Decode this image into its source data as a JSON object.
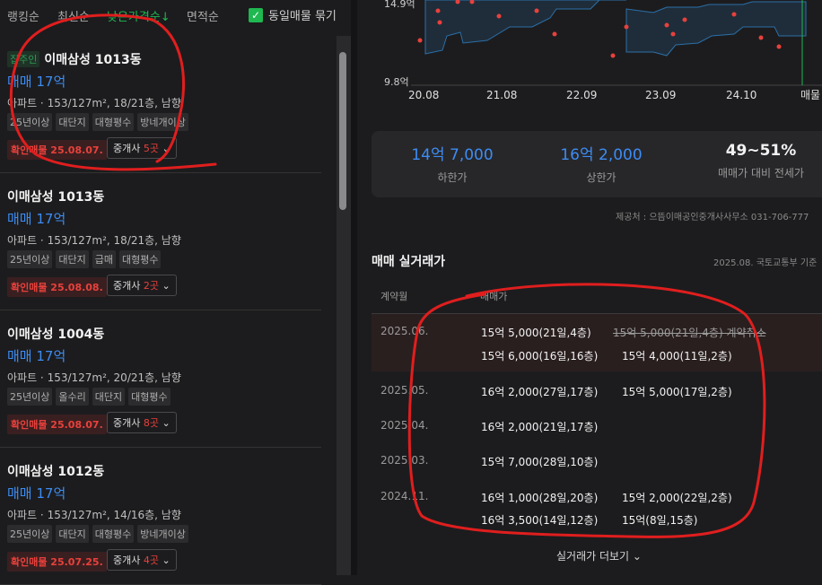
{
  "sort": {
    "items": [
      "랭킹순",
      "최신순",
      "낮은가격순↓",
      "면적순"
    ],
    "active": 2,
    "dup_label": "동일매물 묶기",
    "dup_checked": true
  },
  "listings": [
    {
      "badge": "집주인",
      "name": "이매삼성 1013동",
      "price": "매매 17억",
      "desc": "아파트 · 153/127m², 18/21층, 남향",
      "tags": [
        "25년이상",
        "대단지",
        "대형평수",
        "방네개이상"
      ],
      "confirm": "확인매물 25.08.07.",
      "agent_prefix": "중개사",
      "agent_count": "5곳"
    },
    {
      "badge": "",
      "name": "이매삼성 1013동",
      "price": "매매 17억",
      "desc": "아파트 · 153/127m², 18/21층, 남향",
      "tags": [
        "25년이상",
        "대단지",
        "급매",
        "대형평수"
      ],
      "confirm": "확인매물 25.08.08.",
      "agent_prefix": "중개사",
      "agent_count": "2곳"
    },
    {
      "badge": "",
      "name": "이매삼성 1004동",
      "price": "매매 17억",
      "desc": "아파트 · 153/127m², 20/21층, 남향",
      "tags": [
        "25년이상",
        "올수리",
        "대단지",
        "대형평수"
      ],
      "confirm": "확인매물 25.08.07.",
      "agent_prefix": "중개사",
      "agent_count": "8곳"
    },
    {
      "badge": "",
      "name": "이매삼성 1012동",
      "price": "매매 17억",
      "desc": "아파트 · 153/127m², 14/16층, 남향",
      "tags": [
        "25년이상",
        "대단지",
        "대형평수",
        "방네개이상"
      ],
      "confirm": "확인매물 25.07.25.",
      "agent_prefix": "중개사",
      "agent_count": "4곳"
    }
  ],
  "chart": {
    "y_labels": [
      "14.9억",
      "9.8억"
    ],
    "x_labels": [
      "20.08",
      "21.08",
      "22.09",
      "23.09",
      "24.10",
      "매물"
    ]
  },
  "stats": [
    {
      "value": "14억 7,000",
      "label": "하한가"
    },
    {
      "value": "16억 2,000",
      "label": "상한가"
    },
    {
      "value": "49~51%",
      "label": "매매가 대비 전세가"
    }
  ],
  "source": "제공처 : 으뜸이매공인중개사사무소 031-706-777",
  "section": {
    "title": "매매 실거래가",
    "subtitle": "2025.08. 국토교통부 기준"
  },
  "table": {
    "headers": [
      "계약월",
      "매매가"
    ],
    "rows": [
      {
        "month": "2025.06.",
        "entries": [
          [
            "15억 5,000(21일,4층)",
            "15억 5,000(21일,4층) 계약취소"
          ],
          [
            "15억 6,000(16일,16층)",
            "15억 4,000(11일,2층)"
          ]
        ]
      },
      {
        "month": "2025.05.",
        "entries": [
          [
            "16억 2,000(27일,17층)",
            "15억 5,000(17일,2층)"
          ]
        ]
      },
      {
        "month": "2025.04.",
        "entries": [
          [
            "16억 2,000(21일,17층)"
          ]
        ]
      },
      {
        "month": "2025.03.",
        "entries": [
          [
            "15억 7,000(28일,10층)"
          ]
        ]
      },
      {
        "month": "2024.11.",
        "entries": [
          [
            "16억 1,000(28일,20층)",
            "15억 2,000(22일,2층)"
          ],
          [
            "16억 3,500(14일,12층)",
            "15억(8일,15층)"
          ]
        ]
      }
    ]
  },
  "more": "실거래가 더보기",
  "colors": {
    "accent": "#1fb851",
    "price": "#3d8cf2",
    "alert": "#e8413c",
    "annotation": "#e01e1e"
  }
}
